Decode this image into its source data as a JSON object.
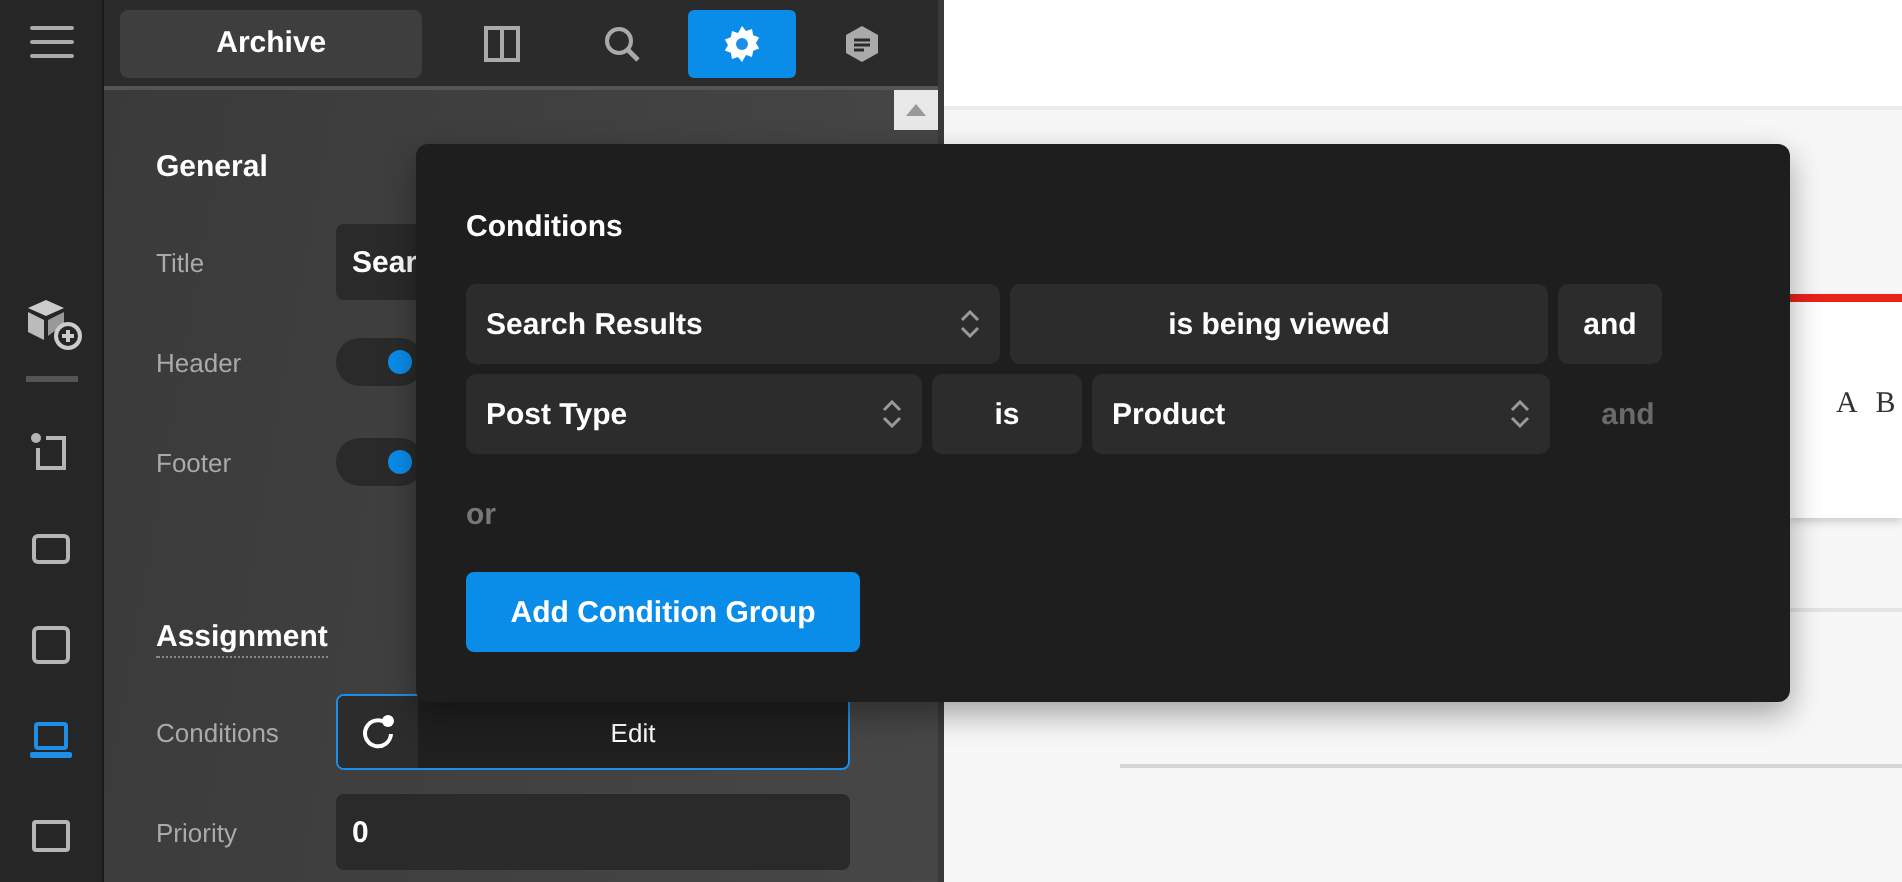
{
  "rail": {
    "items": [
      {
        "kind": "frame",
        "selected": false
      },
      {
        "kind": "landscape",
        "selected": false
      },
      {
        "kind": "square",
        "selected": false
      },
      {
        "kind": "laptop",
        "selected": true
      },
      {
        "kind": "monitor",
        "selected": false
      }
    ]
  },
  "toolbar": {
    "title": "Archive",
    "tabs": [
      {
        "kind": "layout",
        "selected": false
      },
      {
        "kind": "search",
        "selected": false
      },
      {
        "kind": "settings",
        "selected": true
      },
      {
        "kind": "notes",
        "selected": false
      }
    ]
  },
  "general": {
    "heading": "General",
    "fields": [
      {
        "kind": "text",
        "label": "Title",
        "value": "Sear"
      },
      {
        "kind": "toggle",
        "label": "Header",
        "on": true
      },
      {
        "kind": "toggle",
        "label": "Footer",
        "on": true
      }
    ]
  },
  "assignment": {
    "heading": "Assignment",
    "fields": [
      {
        "kind": "button",
        "label": "Conditions",
        "value": "Edit"
      },
      {
        "kind": "text",
        "label": "Priority",
        "value": "0"
      }
    ]
  },
  "conditions_popup": {
    "title": "Conditions",
    "rows": [
      {
        "cells": [
          {
            "kind": "select",
            "text": "Search Results"
          },
          {
            "kind": "box",
            "text": "is being viewed"
          }
        ],
        "connector": {
          "text": "and",
          "active": true
        }
      },
      {
        "cells": [
          {
            "kind": "select",
            "text": "Post Type"
          },
          {
            "kind": "box",
            "text": "is"
          },
          {
            "kind": "select",
            "text": "Product"
          }
        ],
        "connector": {
          "text": "and",
          "active": false
        }
      }
    ],
    "separator": "or",
    "button": "Add Condition Group"
  },
  "canvas": {
    "heading": "A B"
  }
}
